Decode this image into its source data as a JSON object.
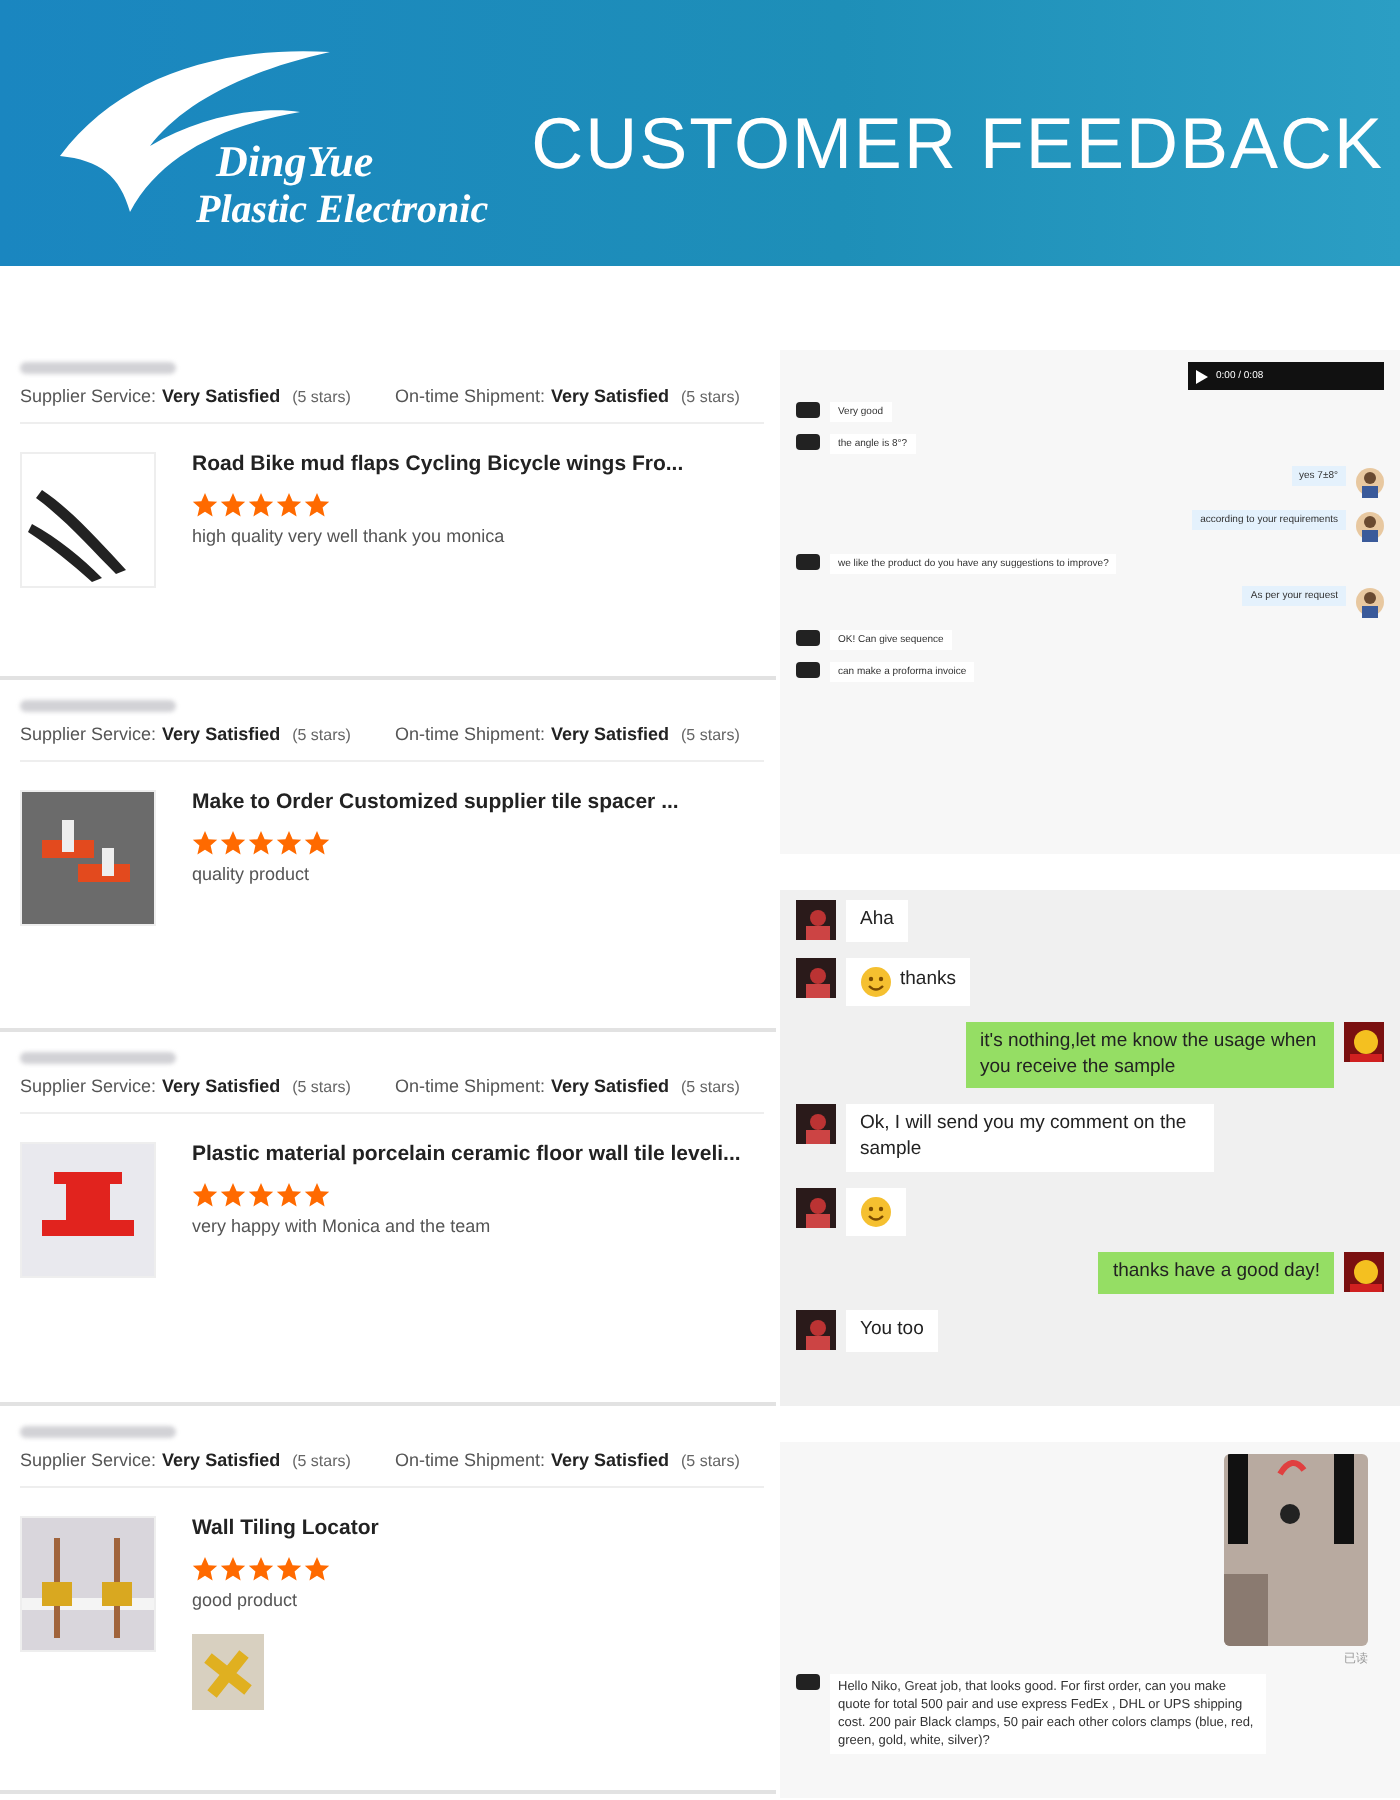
{
  "banner": {
    "brand": "DingYue",
    "tagline": "Plastic Electronic",
    "title": "CUSTOMER FEEDBACK"
  },
  "reviews": [
    {
      "ratings": [
        {
          "label": "Supplier Service:",
          "value": "Very Satisfied",
          "stars_text": "(5 stars)"
        },
        {
          "label": "On-time Shipment:",
          "value": "Very Satisfied",
          "stars_text": "(5 stars)"
        }
      ],
      "product": "Road Bike mud flaps Cycling Bicycle wings Fro...",
      "stars": 5,
      "comment": "high quality very well thank you monica",
      "attachment": false
    },
    {
      "ratings": [
        {
          "label": "Supplier Service:",
          "value": "Very Satisfied",
          "stars_text": "(5 stars)"
        },
        {
          "label": "On-time Shipment:",
          "value": "Very Satisfied",
          "stars_text": "(5 stars)"
        }
      ],
      "product": "Make to Order Customized supplier tile spacer ...",
      "stars": 5,
      "comment": "quality product",
      "attachment": false
    },
    {
      "ratings": [
        {
          "label": "Supplier Service:",
          "value": "Very Satisfied",
          "stars_text": "(5 stars)"
        },
        {
          "label": "On-time Shipment:",
          "value": "Very Satisfied",
          "stars_text": "(5 stars)"
        }
      ],
      "product": "Plastic material porcelain ceramic floor wall tile leveli...",
      "stars": 5,
      "comment": "very happy with Monica and the team",
      "attachment": false
    },
    {
      "ratings": [
        {
          "label": "Supplier Service:",
          "value": "Very Satisfied",
          "stars_text": "(5 stars)"
        },
        {
          "label": "On-time Shipment:",
          "value": "Very Satisfied",
          "stars_text": "(5 stars)"
        }
      ],
      "product": "Wall Tiling Locator",
      "stars": 5,
      "comment": "good product",
      "attachment": true
    }
  ],
  "chats": [
    {
      "messages": [
        {
          "kind": "video_out",
          "time": "0:00 / 0:08"
        },
        {
          "kind": "text_in",
          "text": "Very good"
        },
        {
          "kind": "text_in",
          "text": "the angle is 8°?"
        },
        {
          "kind": "text_out",
          "text": "yes 7±8°"
        },
        {
          "kind": "text_out",
          "text": "according to your requirements"
        },
        {
          "kind": "text_in",
          "text": "we like the product do you have any suggestions to improve?"
        },
        {
          "kind": "text_out",
          "text": "As per your request"
        },
        {
          "kind": "text_in",
          "text": "OK! Can give sequence"
        },
        {
          "kind": "text_in",
          "text": "can make a proforma invoice"
        }
      ]
    },
    {
      "messages": [
        {
          "kind": "text_in",
          "text": "Aha"
        },
        {
          "kind": "emojitext_in",
          "text": "thanks"
        },
        {
          "kind": "text_out",
          "text": "it's nothing,let me know the usage when you receive the sample"
        },
        {
          "kind": "text_in",
          "text": "Ok, I will send you my comment on the sample"
        },
        {
          "kind": "emoji_in"
        },
        {
          "kind": "text_out",
          "text": "thanks have a good day!"
        },
        {
          "kind": "text_in",
          "text": "You too"
        }
      ]
    },
    {
      "messages": [
        {
          "kind": "photo_out",
          "status": "已读"
        },
        {
          "kind": "text_in",
          "text": "Hello Niko, Great job, that looks good. For first order, can you make quote for total 500 pair and use express FedEx , DHL or UPS shipping cost. 200 pair Black clamps, 50 pair each other colors clamps (blue, red, green, gold, white, silver)?"
        }
      ]
    }
  ]
}
